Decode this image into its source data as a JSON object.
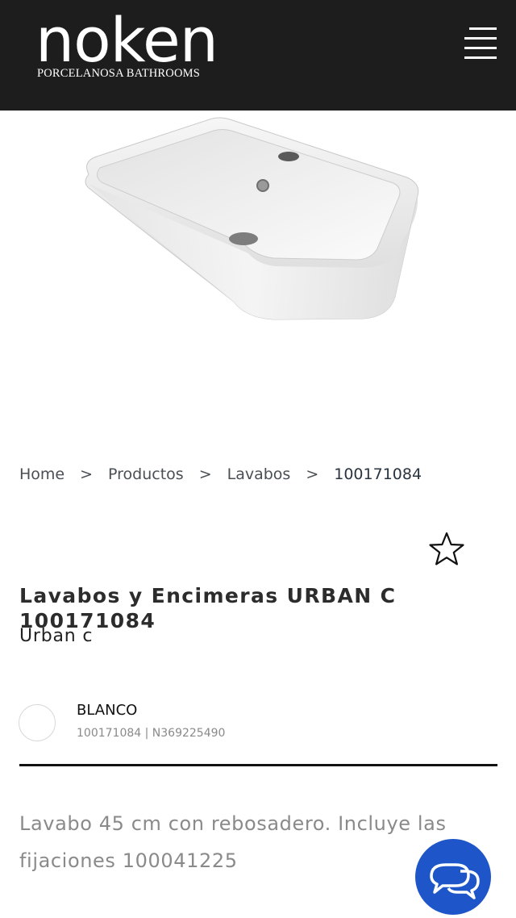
{
  "header": {
    "logo_word": "noken",
    "logo_tagline": "PORCELANOSA BATHROOMS",
    "menu_icon": "hamburger-menu-icon",
    "background": "#1d1d1d"
  },
  "product_image": {
    "subject": "white ceramic washbasin"
  },
  "breadcrumb": {
    "items": [
      "Home",
      "Productos",
      "Lavabos",
      "100171084"
    ],
    "separator": ">"
  },
  "product": {
    "title": "Lavabos y Encimeras URBAN C 100171084",
    "subtitle": "Urban c",
    "favorite_icon": "star-outline-icon"
  },
  "variant": {
    "color_name": "BLANCO",
    "codes": "100171084 | N369225490",
    "swatch_color": "#ffffff"
  },
  "description": "Lavabo 45 cm con rebosadero. Incluye las fijaciones 100041225",
  "chat": {
    "icon": "chat-bubbles-icon",
    "color": "#1e56c9"
  }
}
